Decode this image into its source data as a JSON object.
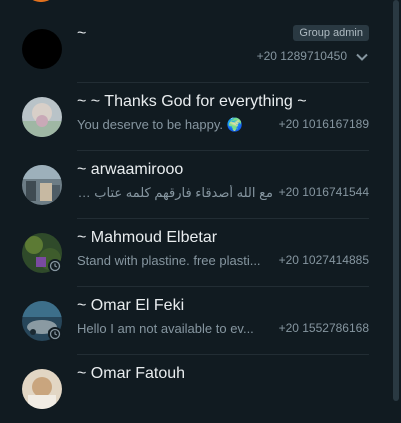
{
  "members": [
    {
      "name": "~",
      "badge": "Group admin",
      "phone": "+20 1289710450",
      "snippet": "",
      "avatar": "black"
    },
    {
      "name": "~ ~ Thanks God for everything ~",
      "snippet": "You deserve to be happy. 🌍",
      "phone": "+20 1016167189",
      "avatar": "photo-pastel"
    },
    {
      "name": "~ arwaamirooo",
      "snippet": "مع الله أصدقاء فارقهم كلمه عتاب 💫",
      "phone": "+20 1016741544",
      "avatar": "photo-street"
    },
    {
      "name": "~ Mahmoud Elbetar",
      "snippet": "Stand with plastine. free plasti...",
      "phone": "+20 1027414885",
      "avatar": "photo-green"
    },
    {
      "name": "~ Omar El Feki",
      "snippet": "Hello I am not available to ev...",
      "phone": "+20 1552786168",
      "avatar": "photo-car"
    },
    {
      "name": "~ Omar Fatouh",
      "snippet": "",
      "phone": "",
      "avatar": "photo-beige"
    }
  ],
  "colors": {
    "background": "#111b21",
    "primary_text": "#e9edef",
    "secondary_text": "#8696a0",
    "badge_bg": "#2a3942",
    "divider": "#222d34"
  },
  "icons": [
    "chevron-down-icon",
    "status-ring-icon"
  ]
}
